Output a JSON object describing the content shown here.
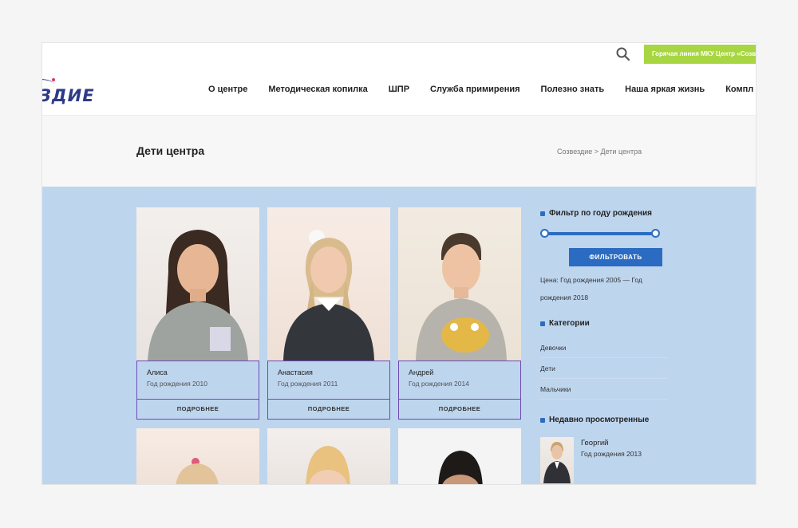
{
  "header": {
    "hotline_label": "Горячая линия МКУ Центр «Созв",
    "logo_text": "ЗДИЕ",
    "nav": [
      "О центре",
      "Методическая копилка",
      "ШПР",
      "Служба примирения",
      "Полезно знать",
      "Наша яркая жизнь",
      "Компл"
    ]
  },
  "titlebar": {
    "title": "Дети центра",
    "breadcrumb": "Созвездие > Дети центра"
  },
  "children": [
    {
      "name": "Алиса",
      "year": "Год рождения 2010",
      "more": "ПОДРОБНЕЕ"
    },
    {
      "name": "Анастасия",
      "year": "Год рождения 2011",
      "more": "ПОДРОБНЕЕ"
    },
    {
      "name": "Андрей",
      "year": "Год рождения 2014",
      "more": "ПОДРОБНЕЕ"
    }
  ],
  "sidebar": {
    "filter_title": "Фильтр по году рождения",
    "filter_button": "ФИЛЬТРОВАТЬ",
    "range_text": "Цена: Год рождения 2005 — Год рождения 2018",
    "categories_title": "Категории",
    "categories": [
      "Девочки",
      "Дети",
      "Мальчики"
    ],
    "recent_title": "Недавно просмотренные",
    "recent": {
      "name": "Георгий",
      "year": "Год рождения 2013"
    }
  },
  "colors": {
    "accent": "#2b6cc2",
    "content_bg": "#bed5ee",
    "card_border": "#6a4bb5",
    "hotline_bg": "#a8d642",
    "logo": "#2d3b86"
  }
}
